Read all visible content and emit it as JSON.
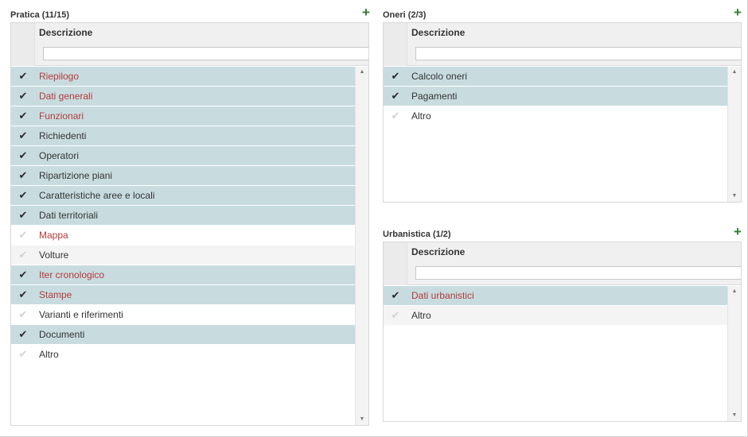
{
  "pratica": {
    "title": "Pratica (11/15)",
    "add_icon": "+",
    "column_header": "Descrizione",
    "filter_placeholder": "",
    "rows": [
      {
        "label": "Riepilogo",
        "checked": true,
        "red": true
      },
      {
        "label": "Dati generali",
        "checked": true,
        "red": true
      },
      {
        "label": "Funzionari",
        "checked": true,
        "red": true
      },
      {
        "label": "Richiedenti",
        "checked": true,
        "red": false
      },
      {
        "label": "Operatori",
        "checked": true,
        "red": false
      },
      {
        "label": "Ripartizione piani",
        "checked": true,
        "red": false
      },
      {
        "label": "Caratteristiche aree e locali",
        "checked": true,
        "red": false
      },
      {
        "label": "Dati territoriali",
        "checked": true,
        "red": false
      },
      {
        "label": "Mappa",
        "checked": false,
        "red": true
      },
      {
        "label": "Volture",
        "checked": false,
        "red": false
      },
      {
        "label": "Iter cronologico",
        "checked": true,
        "red": true
      },
      {
        "label": "Stampe",
        "checked": true,
        "red": true
      },
      {
        "label": "Varianti e riferimenti",
        "checked": false,
        "red": false
      },
      {
        "label": "Documenti",
        "checked": true,
        "red": false
      },
      {
        "label": "Altro",
        "checked": false,
        "red": false
      }
    ]
  },
  "oneri": {
    "title": "Oneri (2/3)",
    "add_icon": "+",
    "column_header": "Descrizione",
    "filter_placeholder": "",
    "rows": [
      {
        "label": "Calcolo oneri",
        "checked": true,
        "red": false
      },
      {
        "label": "Pagamenti",
        "checked": true,
        "red": false
      },
      {
        "label": "Altro",
        "checked": false,
        "red": false
      }
    ]
  },
  "urbanistica": {
    "title": "Urbanistica (1/2)",
    "add_icon": "+",
    "column_header": "Descrizione",
    "filter_placeholder": "",
    "rows": [
      {
        "label": "Dati urbanistici",
        "checked": true,
        "red": true
      },
      {
        "label": "Altro",
        "checked": false,
        "red": false
      }
    ]
  },
  "icons": {
    "check": "✔",
    "add": "plus-icon",
    "scroll_up": "▲",
    "scroll_down": "▼"
  },
  "colors": {
    "selected_row": "#c8dce0",
    "red_text": "#b33a3a",
    "add_green": "#2e7d32"
  }
}
